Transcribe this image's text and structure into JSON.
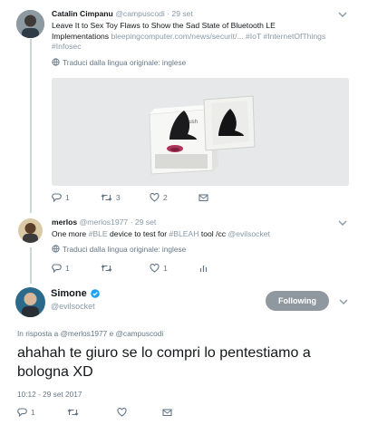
{
  "tweet1": {
    "name": "Catalin Cimpanu",
    "handle": "@campuscodi",
    "date": "· 29 set",
    "text": "Leave It to Sex Toy Flaws to Show the Sad State of Bluetooth LE Implementations",
    "link": "bleepingcomputer.com/news/securit/...",
    "hashtag1": "#IoT",
    "hashtag2": "#InternetOfThings",
    "hashtag3": "#Infosec",
    "translate": "Traduci dalla lingua originale: inglese",
    "media_label": "Hush",
    "replies": "1",
    "retweets": "3",
    "likes": "2"
  },
  "tweet2": {
    "name": "merlos",
    "handle": "@merlos1977",
    "date": "· 29 set",
    "text_prefix": "One more",
    "hashtag1": "#BLE",
    "text_middle": "device to test for",
    "hashtag2": "#BLEAH",
    "text_suffix": "tool /cc",
    "mention": "@evilsocket",
    "translate": "Traduci dalla lingua originale: inglese",
    "replies": "1",
    "likes": "1"
  },
  "main": {
    "name": "Simone",
    "handle": "@evilsocket",
    "follow_label": "Following",
    "reply_to": "In risposta a @merlos1977 e @campuscodi",
    "text": "ahahah te giuro se lo compri lo pentestiamo a bologna XD",
    "timestamp": "10:12 - 29 set 2017",
    "replies": "1"
  },
  "colors": {
    "verified": "#1da1f2",
    "follow_bg": "#8f989f",
    "icon": "#657786"
  }
}
